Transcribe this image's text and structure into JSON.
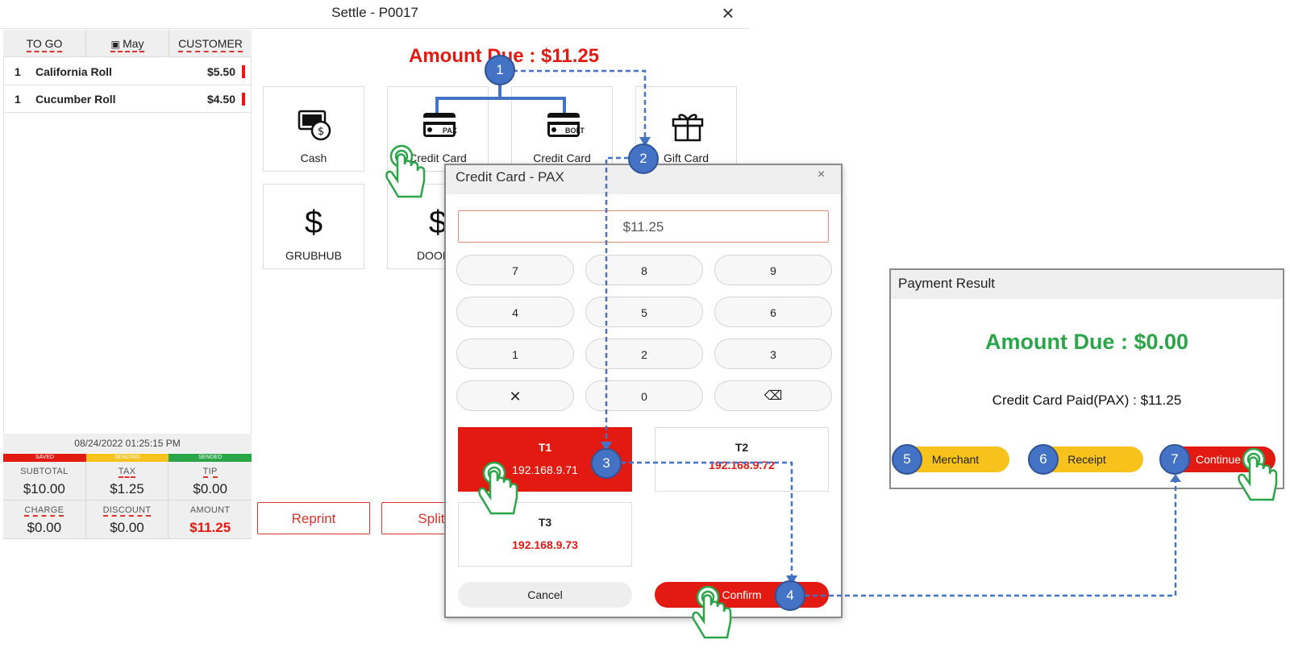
{
  "settle": {
    "title": "Settle - P0017",
    "amount_due": "Amount Due : $11.25",
    "header": {
      "to_go": "TO GO",
      "user": "May",
      "customer": "CUSTOMER"
    },
    "items": [
      {
        "qty": "1",
        "name": "California Roll",
        "price": "$5.50"
      },
      {
        "qty": "1",
        "name": "Cucumber Roll",
        "price": "$4.50"
      }
    ],
    "timestamp": "08/24/2022 01:25:15 PM",
    "status": {
      "saved": "SAVED",
      "sending": "SENDING",
      "sended": "SENDED"
    },
    "totals": {
      "subtotal_label": "SUBTOTAL",
      "subtotal": "$10.00",
      "tax_label": "TAX",
      "tax": "$1.25",
      "tip_label": "TIP",
      "tip": "$0.00",
      "charge_label": "CHARGE",
      "charge": "$0.00",
      "discount_label": "DISCOUNT",
      "discount": "$0.00",
      "amount_label": "AMOUNT",
      "amount": "$11.25"
    },
    "tiles": {
      "cash": "Cash",
      "credit_pax": "Credit Card",
      "credit_pax_badge": "PAX",
      "credit_bolt": "Credit Card",
      "credit_bolt_badge": "BOLT",
      "gift": "Gift Card",
      "grubhub": "GRUBHUB",
      "doordash": "DOORD"
    },
    "buttons": {
      "reprint": "Reprint",
      "split": "Split B"
    }
  },
  "dialog": {
    "title": "Credit Card - PAX",
    "close": "×",
    "amount": "$11.25",
    "keys": [
      "7",
      "8",
      "9",
      "4",
      "5",
      "6",
      "1",
      "2",
      "3",
      "✕",
      "0",
      "⌫"
    ],
    "terminals": [
      {
        "name": "T1",
        "ip": "192.168.9.71"
      },
      {
        "name": "T2",
        "ip": "192.168.9.72"
      },
      {
        "name": "T3",
        "ip": "192.168.9.73"
      }
    ],
    "cancel": "Cancel",
    "confirm": "Confirm"
  },
  "result": {
    "title": "Payment Result",
    "amount_due": "Amount Due : $0.00",
    "paid": "Credit Card Paid(PAX) : $11.25",
    "merchant": "Merchant",
    "receipt": "Receipt",
    "continue": "Continue"
  },
  "steps": [
    "1",
    "2",
    "3",
    "4",
    "5",
    "6",
    "7"
  ],
  "colors": {
    "red": "#e21a12",
    "green": "#2aa548",
    "yellow": "#f7c21b",
    "step_blue": "#4472c4",
    "flow_line": "#4472c4"
  }
}
